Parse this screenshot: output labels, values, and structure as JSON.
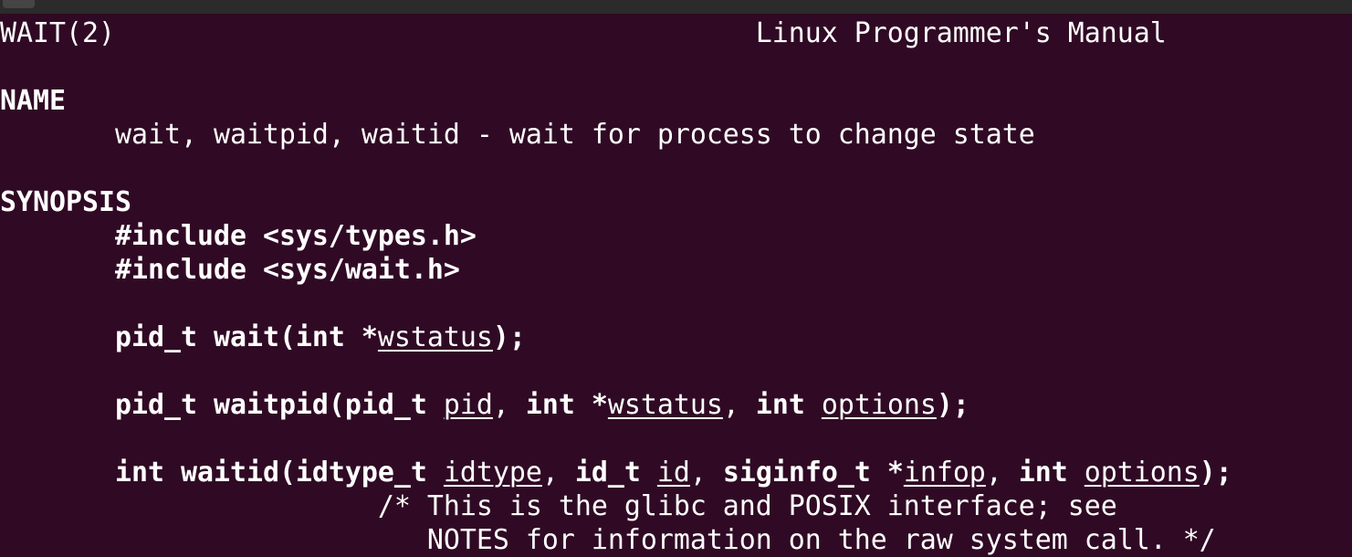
{
  "window": {
    "background": "#300a24",
    "topbar_color": "#2b2b2b",
    "text_color": "#ffffff"
  },
  "lines": [
    [
      {
        "t": "WAIT(2)                                       Linux Programmer's Manual",
        "s": ""
      }
    ],
    [],
    [
      {
        "t": "NAME",
        "s": "b"
      }
    ],
    [
      {
        "t": "       wait, waitpid, waitid - wait for process to change state",
        "s": ""
      }
    ],
    [],
    [
      {
        "t": "SYNOPSIS",
        "s": "b"
      }
    ],
    [
      {
        "t": "       ",
        "s": ""
      },
      {
        "t": "#include <sys/types.h>",
        "s": "b"
      }
    ],
    [
      {
        "t": "       ",
        "s": ""
      },
      {
        "t": "#include <sys/wait.h>",
        "s": "b"
      }
    ],
    [],
    [
      {
        "t": "       ",
        "s": ""
      },
      {
        "t": "pid_t wait(int *",
        "s": "b"
      },
      {
        "t": "wstatus",
        "s": "u"
      },
      {
        "t": ");",
        "s": "b"
      }
    ],
    [],
    [
      {
        "t": "       ",
        "s": ""
      },
      {
        "t": "pid_t waitpid(pid_t ",
        "s": "b"
      },
      {
        "t": "pid",
        "s": "u"
      },
      {
        "t": ", ",
        "s": ""
      },
      {
        "t": "int *",
        "s": "b"
      },
      {
        "t": "wstatus",
        "s": "u"
      },
      {
        "t": ", ",
        "s": ""
      },
      {
        "t": "int ",
        "s": "b"
      },
      {
        "t": "options",
        "s": "u"
      },
      {
        "t": ");",
        "s": "b"
      }
    ],
    [],
    [
      {
        "t": "       ",
        "s": ""
      },
      {
        "t": "int waitid(idtype_t ",
        "s": "b"
      },
      {
        "t": "idtype",
        "s": "u"
      },
      {
        "t": ", ",
        "s": ""
      },
      {
        "t": "id_t ",
        "s": "b"
      },
      {
        "t": "id",
        "s": "u"
      },
      {
        "t": ", ",
        "s": ""
      },
      {
        "t": "siginfo_t *",
        "s": "b"
      },
      {
        "t": "infop",
        "s": "u"
      },
      {
        "t": ", ",
        "s": ""
      },
      {
        "t": "int ",
        "s": "b"
      },
      {
        "t": "options",
        "s": "u"
      },
      {
        "t": ");",
        "s": "b"
      }
    ],
    [
      {
        "t": "                       /* This is the glibc and POSIX interface; see",
        "s": ""
      }
    ],
    [
      {
        "t": "                          NOTES for information on the raw system call. */",
        "s": ""
      }
    ]
  ]
}
